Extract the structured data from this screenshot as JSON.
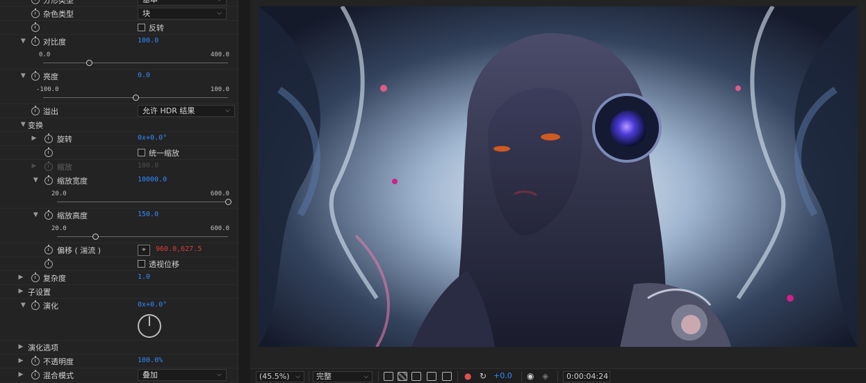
{
  "effect_controls": {
    "fractal_type": {
      "label": "分形类型",
      "value": "基本"
    },
    "noise_type": {
      "label": "杂色类型",
      "value": "块"
    },
    "invert": {
      "label": "反转"
    },
    "contrast": {
      "label": "对比度",
      "value": "100.0",
      "min": "0.0",
      "max": "400.0",
      "fraction": 0.25
    },
    "brightness": {
      "label": "亮度",
      "value": "0.0",
      "min": "-100.0",
      "max": "100.0",
      "fraction": 0.5
    },
    "overflow": {
      "label": "溢出",
      "value": "允许 HDR 结果"
    },
    "transform": {
      "label": "变换"
    },
    "rotation": {
      "label": "旋转",
      "value": "0x+0.0°"
    },
    "uniform_scaling": {
      "label": "统一缩放"
    },
    "scale": {
      "label": "缩放",
      "value": "100.0"
    },
    "scale_width": {
      "label": "缩放宽度",
      "value": "10000.0",
      "min": "20.0",
      "max": "600.0",
      "fraction": 1.0
    },
    "scale_height": {
      "label": "缩放高度",
      "value": "150.0",
      "min": "20.0",
      "max": "600.0",
      "fraction": 0.224
    },
    "offset": {
      "label": "偏移 ( 湍流 )",
      "value": "960.0,627.5"
    },
    "perspective_offset": {
      "label": "透视位移"
    },
    "complexity": {
      "label": "复杂度",
      "value": "1.0"
    },
    "sub_settings": {
      "label": "子设置"
    },
    "evolution": {
      "label": "演化",
      "value": "0x+0.0°"
    },
    "evolution_options": {
      "label": "演化选项"
    },
    "opacity": {
      "label": "不透明度",
      "value": "100.0%"
    },
    "blend_mode": {
      "label": "混合模式",
      "value": "叠加"
    }
  },
  "viewer": {
    "zoom": "(45.5%)",
    "resolution": "完整",
    "exposure": "+0.0",
    "timecode": "0:00:04:24"
  },
  "icons": [
    "stopwatch-icon",
    "chevron-right-icon",
    "chevron-down-icon",
    "target-icon",
    "snapshot-icon",
    "color-channels-icon"
  ]
}
